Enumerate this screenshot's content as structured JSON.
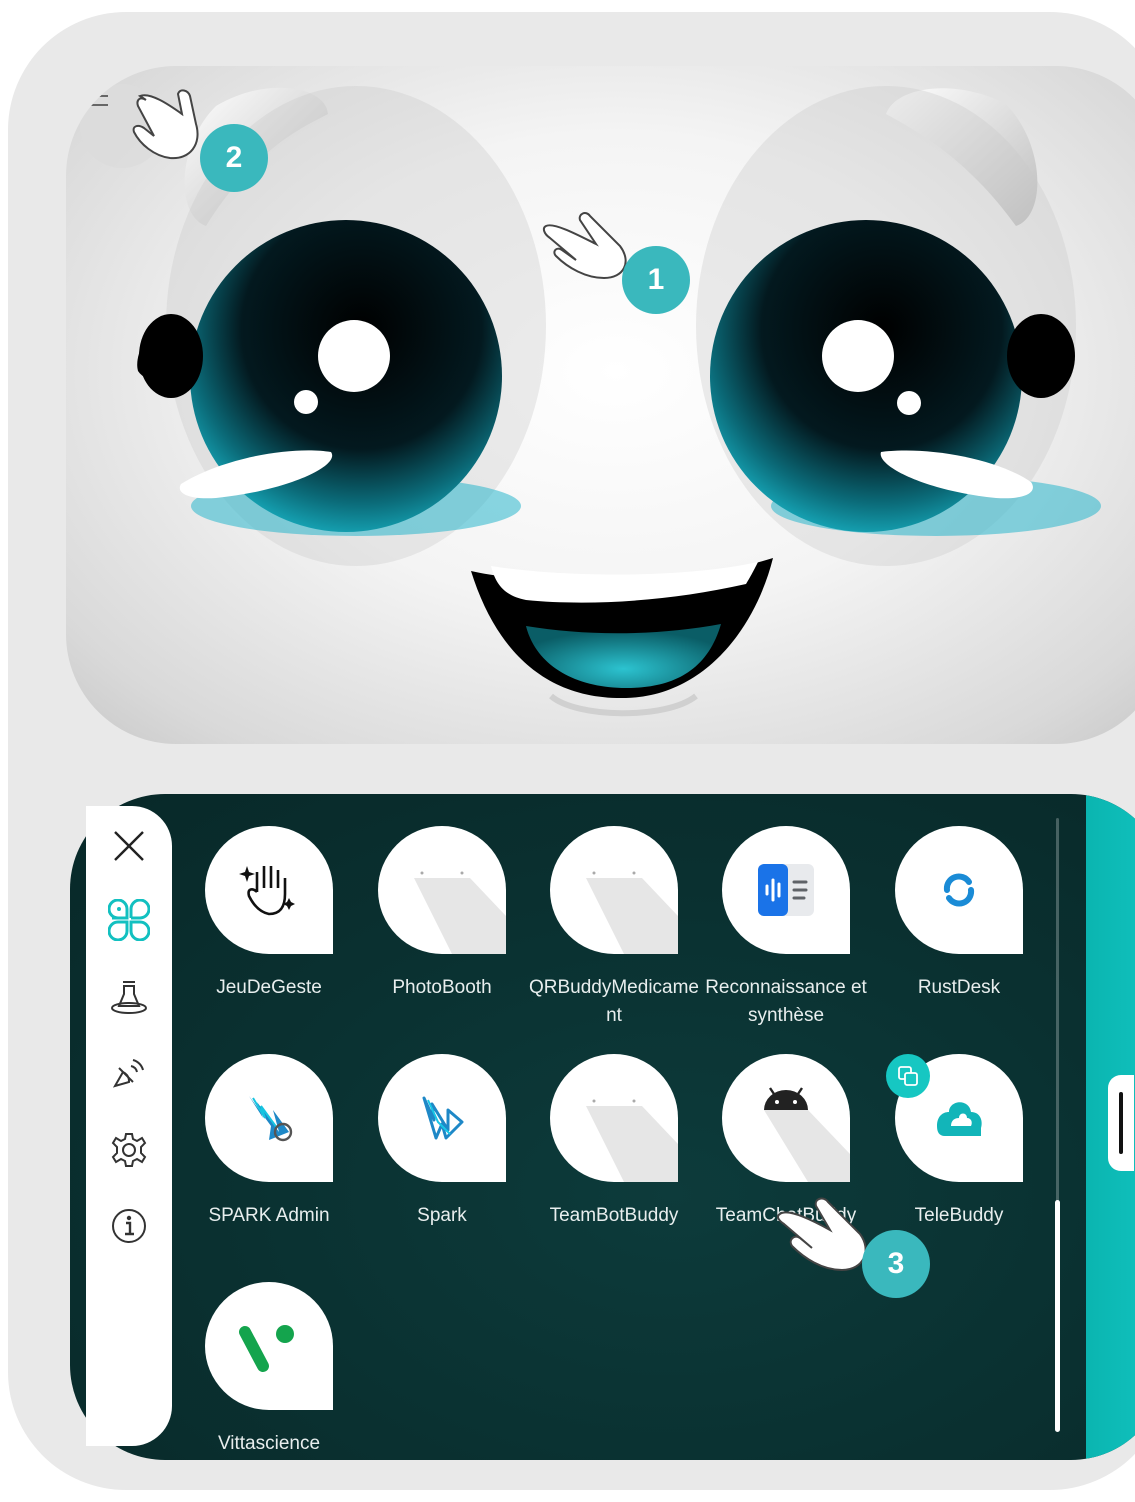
{
  "step_badges": [
    "1",
    "2",
    "3"
  ],
  "apps": [
    {
      "label": "JeuDeGeste",
      "icon": "gesture-hand-icon"
    },
    {
      "label": "PhotoBooth",
      "icon": "placeholder-app-icon"
    },
    {
      "label": "QRBuddyMedicament",
      "icon": "placeholder-app-icon"
    },
    {
      "label": "Reconnaissance et synthèse",
      "icon": "speech-document-icon"
    },
    {
      "label": "RustDesk",
      "icon": "rustdesk-icon"
    },
    {
      "label": "SPARK Admin",
      "icon": "spark-admin-icon"
    },
    {
      "label": "Spark",
      "icon": "spark-icon"
    },
    {
      "label": "TeamBotBuddy",
      "icon": "placeholder-app-icon"
    },
    {
      "label": "TeamChatBuddy",
      "icon": "android-icon"
    },
    {
      "label": "TeleBuddy",
      "icon": "telebuddy-icon"
    },
    {
      "label": "Vittascience",
      "icon": "vittascience-icon"
    }
  ],
  "sidebar": [
    "close-icon",
    "apps-icon",
    "robot-icon",
    "sensor-icon",
    "settings-icon",
    "info-icon"
  ],
  "colors": {
    "accent": "#3ab8bd",
    "drawer": "#0a3131",
    "eye": "#0fa3b5"
  }
}
